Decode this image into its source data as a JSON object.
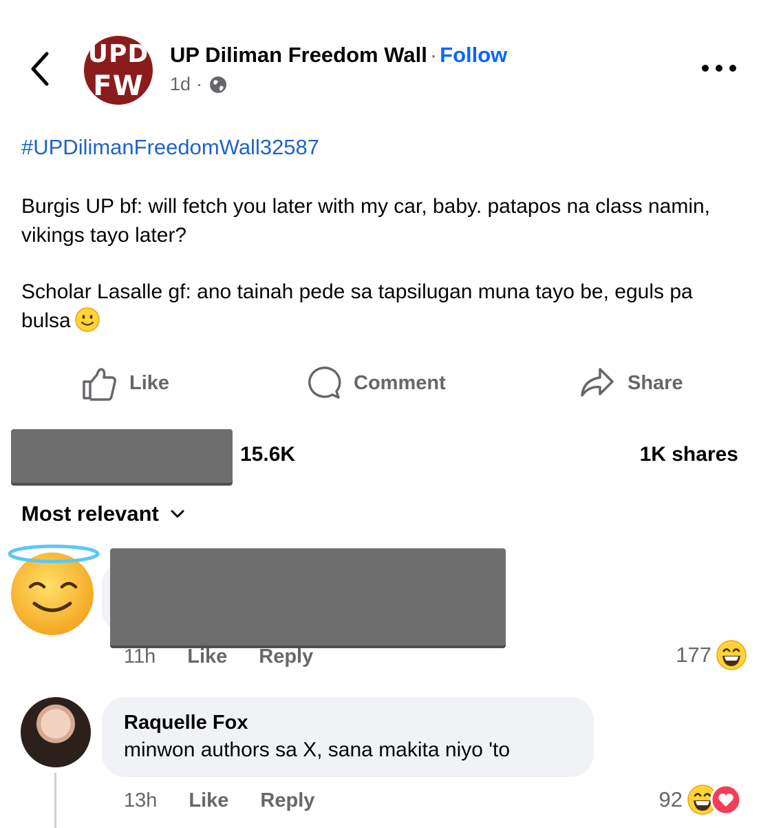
{
  "header": {
    "page_name": "UP Diliman Freedom Wall",
    "separator": "·",
    "follow_label": "Follow",
    "time": "1d",
    "meta_separator": "·",
    "audience_icon": "globe-icon",
    "logo": {
      "line1": "UPD",
      "line2": "FW"
    }
  },
  "post": {
    "hashtag": "#UPDilimanFreedomWall32587",
    "paragraphs": [
      "Burgis UP bf: will fetch you later with my car, baby. patapos na class namin, vikings tayo later?",
      "Scholar Lasalle gf: ano tainah pede sa tapsilugan muna tayo be, eguls pa bulsa"
    ],
    "emoji": "slightly-smiling-face-emoji"
  },
  "actions": {
    "like": "Like",
    "comment": "Comment",
    "share": "Share"
  },
  "stats": {
    "reactions": "15.6K",
    "shares": "1K shares"
  },
  "sort_label": "Most relevant",
  "comments": [
    {
      "avatar": "smiling-face-with-halo-emoji",
      "time": "11h",
      "like": "Like",
      "reply": "Reply",
      "reaction_count": "177",
      "reactions": [
        "laughing-emoji"
      ]
    },
    {
      "author": "Raquelle Fox",
      "text": "minwon authors sa X, sana makita niyo 'to",
      "time": "13h",
      "like": "Like",
      "reply": "Reply",
      "reaction_count": "92",
      "reactions": [
        "laughing-emoji",
        "heart-emoji"
      ]
    }
  ],
  "colors": {
    "link": "#0866ff",
    "hashtag": "#1e63c9",
    "secondary_text": "#65676b",
    "logo": "#8b1c1c",
    "bubble": "#f0f2f5"
  }
}
